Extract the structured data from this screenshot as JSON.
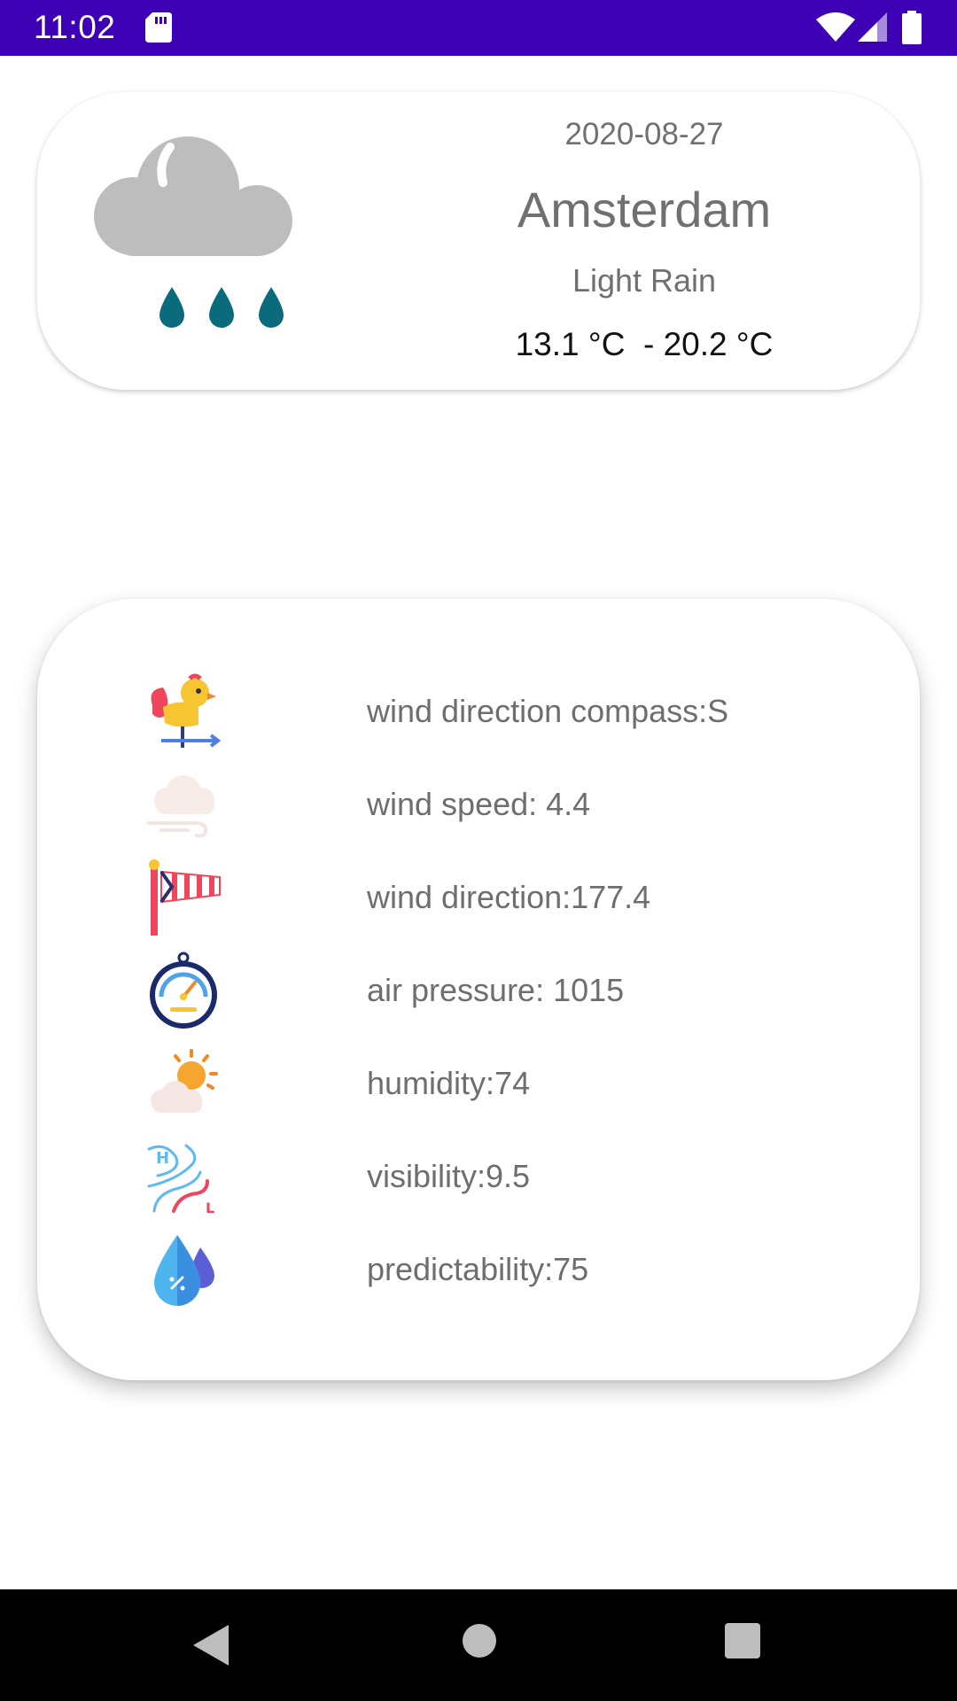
{
  "status_bar": {
    "time": "11:02",
    "background": "#3d00b5",
    "icons": [
      "sd-card-icon",
      "wifi-icon",
      "signal-icon",
      "battery-icon"
    ]
  },
  "summary": {
    "date": "2020-08-27",
    "city": "Amsterdam",
    "condition": "Light Rain",
    "temp_range": "13.1 °C  - 20.2 °C",
    "icon": "light-rain-icon"
  },
  "details": [
    {
      "label": "wind direction compass:S",
      "icon": "weathervane-icon"
    },
    {
      "label": "wind speed: 4.4",
      "icon": "wind-cloud-icon"
    },
    {
      "label": "wind direction:177.4",
      "icon": "windsock-icon"
    },
    {
      "label": "air pressure: 1015",
      "icon": "barometer-icon"
    },
    {
      "label": "humidity:74",
      "icon": "sun-cloud-icon"
    },
    {
      "label": "visibility:9.5",
      "icon": "pressure-map-icon"
    },
    {
      "label": "predictability:75",
      "icon": "water-drops-icon"
    }
  ],
  "nav_bar": {
    "buttons": [
      "back-icon",
      "home-icon",
      "recents-icon"
    ]
  }
}
